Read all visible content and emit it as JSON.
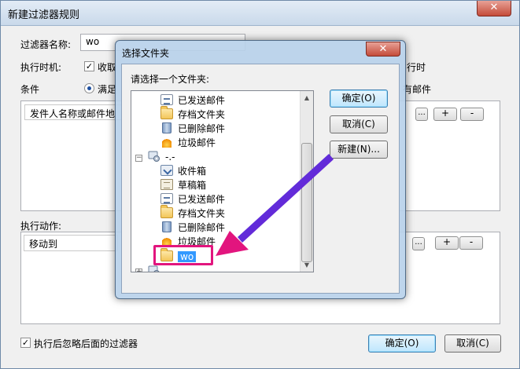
{
  "background_dialog": {
    "title": "新建过滤器规则",
    "close_glyph": "✕",
    "filter_name_label": "过滤器名称:",
    "filter_name_value": "wo",
    "exec_time_label": "执行时机:",
    "exec_time_check_text": "收取",
    "exec_time_right_text": "行时",
    "condition_label": "条件",
    "condition_radio_text": "满足",
    "condition_right_text": "有邮件",
    "condition_item": "发件人名称或邮件地",
    "action_label": "执行动作:",
    "action_item": "移动到",
    "dots_button": "...",
    "add_button": "+",
    "remove_button": "-",
    "ignore_checkbox_label": "执行后忽略后面的过滤器",
    "ok_button": "确定(O)",
    "cancel_button": "取消(C)"
  },
  "modal": {
    "title": "选择文件夹",
    "close_glyph": "✕",
    "prompt": "请选择一个文件夹:",
    "ok_button": "确定(O)",
    "cancel_button": "取消(C)",
    "new_button": "新建(N)...",
    "tree": {
      "account1_items": [
        "已发送邮件",
        "存档文件夹",
        "已删除邮件",
        "垃圾邮件"
      ],
      "account2_label": "-.-",
      "account2_items": [
        "收件箱",
        "草稿箱",
        "已发送邮件",
        "存档文件夹",
        "已删除邮件",
        "垃圾邮件"
      ],
      "selected_folder": "wo",
      "account3_label": "-.-",
      "expand_minus": "−",
      "expand_plus": "+",
      "scroll_up": "▲",
      "scroll_down": "▼"
    }
  },
  "annotation": {
    "arrow_color": "#1f26d6",
    "highlight_color": "#e2157e"
  }
}
